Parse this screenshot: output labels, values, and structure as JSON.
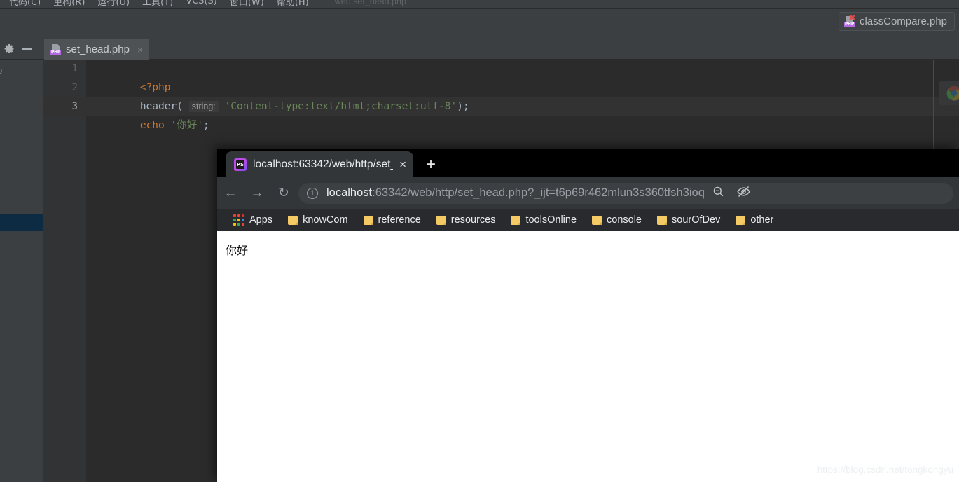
{
  "ide": {
    "menus": [
      {
        "label": "代码(C)"
      },
      {
        "label": "重构(R)"
      },
      {
        "label": "运行(U)"
      },
      {
        "label": "工具(T)"
      },
      {
        "label": "VCS(S)"
      },
      {
        "label": "窗口(W)"
      },
      {
        "label": "帮助(H)"
      }
    ],
    "breadcrumb": "web  set_head.php",
    "secondary_tab": {
      "label": "classCompare.php",
      "icon": "php-file-error-icon"
    },
    "left_strip": {
      "gear_icon": "gear-icon",
      "collapse_icon": "minus-icon",
      "clipped_label": "o"
    },
    "editor": {
      "tab": {
        "label": "set_head.php",
        "close": "×",
        "icon": "php-file-icon"
      },
      "line_numbers": [
        "1",
        "2",
        "3"
      ],
      "current_line": 3,
      "code": {
        "line1": {
          "open_tag": "<?php"
        },
        "line2": {
          "fn": "header",
          "paren_open": "(",
          "hint": "string:",
          "string": "'Content-type:text/html;charset:utf-8'",
          "tail": ");"
        },
        "line3": {
          "kw": "echo",
          "string": "'你好'",
          "tail": ";"
        }
      }
    },
    "colors": {
      "keyword": "#cc7832",
      "string": "#6a8759",
      "identifier": "#a9b7c6",
      "editor_bg": "#2b2b2b",
      "chrome_bg": "#3c3f41",
      "tree_selection": "#0d2c43"
    }
  },
  "browser": {
    "tab": {
      "title": "localhost:63342/web/http/set_",
      "favicon": "phpstorm-favicon",
      "close_label": "×"
    },
    "new_tab_label": "+",
    "nav": {
      "back": "←",
      "forward": "→",
      "reload": "↻"
    },
    "omnibox": {
      "info_icon": "info-icon",
      "url_strong": "localhost",
      "url_rest": ":63342/web/http/set_head.php?_ijt=t6p69r462mlun3s360tfsh3ioq",
      "full_url": "localhost:63342/web/http/set_head.php?_ijt=t6p69r462mlun3s360tfsh3ioq",
      "zoom_out_icon": "zoom-out-icon",
      "hidden_eye_icon": "eye-slash-icon"
    },
    "bookmarks": [
      {
        "label": "Apps",
        "icon": "apps-grid-icon"
      },
      {
        "label": "knowCom",
        "icon": "folder-icon"
      },
      {
        "label": "reference",
        "icon": "folder-icon"
      },
      {
        "label": "resources",
        "icon": "folder-icon"
      },
      {
        "label": "toolsOnline",
        "icon": "folder-icon"
      },
      {
        "label": "console",
        "icon": "folder-icon"
      },
      {
        "label": "sourOfDev",
        "icon": "folder-icon"
      },
      {
        "label": "other",
        "icon": "folder-icon"
      }
    ],
    "page": {
      "body_text": "你好"
    },
    "colors": {
      "tabstrip": "#000000",
      "toolbar": "#323639",
      "bookmarks_bar": "#292a2d",
      "omnibox": "#3c4043"
    }
  },
  "watermark": "https://blog.csdn.net/tongkongyu"
}
